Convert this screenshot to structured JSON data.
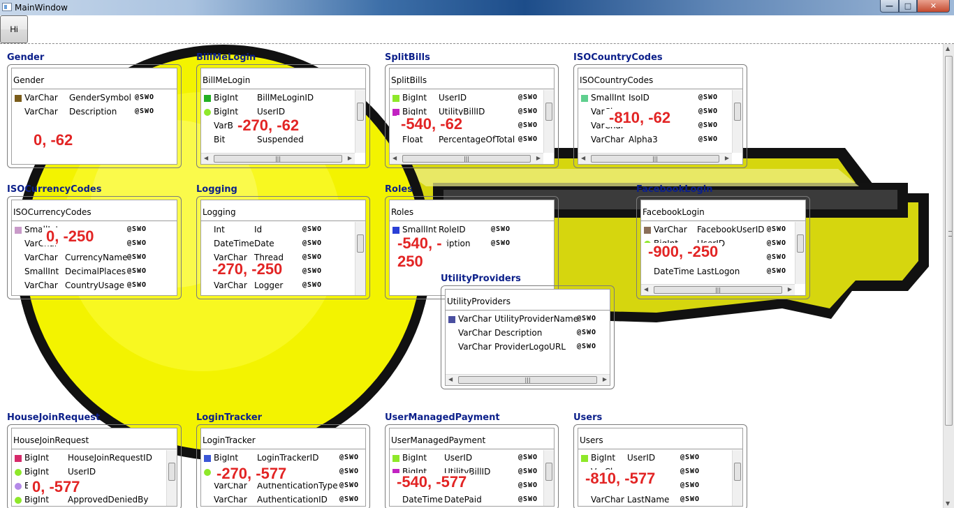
{
  "window": {
    "title": "MainWindow",
    "minimize": "—",
    "maximize": "□",
    "close": "✕"
  },
  "toolbar": {
    "hi_label": "Hi"
  },
  "colors": {
    "title_blue": "#0b1f8a",
    "coord_red": "#e22424"
  },
  "tables": [
    {
      "name": "Gender",
      "header": "Gender",
      "coord": "0, -62",
      "rows": [
        {
          "type": "VarChar",
          "col": "GenderSymbol",
          "color": "#7a5c1a",
          "shape": "sq"
        },
        {
          "type": "VarChar",
          "col": "Description",
          "color": "",
          "shape": "none"
        }
      ]
    },
    {
      "name": "BillMeLogin",
      "header": "BillMeLogin",
      "coord": "-270, -62",
      "rows": [
        {
          "type": "BigInt",
          "col": "BillMeLoginID",
          "color": "#22b022",
          "shape": "sq"
        },
        {
          "type": "BigInt",
          "col": "UserID",
          "color": "#8ee82a",
          "shape": "dot"
        },
        {
          "type": "VarBin",
          "col": "",
          "color": "",
          "shape": "none"
        },
        {
          "type": "Bit",
          "col": "Suspended",
          "color": "",
          "shape": "none"
        }
      ]
    },
    {
      "name": "SplitBills",
      "header": "SplitBills",
      "coord": "-540, -62",
      "rows": [
        {
          "type": "BigInt",
          "col": "UserID",
          "color": "#8ee82a",
          "shape": "sq"
        },
        {
          "type": "BigInt",
          "col": "UtilityBillID",
          "color": "#c222c2",
          "shape": "sq"
        },
        {
          "type": "",
          "col": "",
          "color": "",
          "shape": "none"
        },
        {
          "type": "Float",
          "col": "PercentageOfTotal",
          "color": "",
          "shape": "none"
        }
      ]
    },
    {
      "name": "ISOCountryCodes",
      "header": "ISOCountryCodes",
      "coord": "-810, -62",
      "rows": [
        {
          "type": "SmallInt",
          "col": "IsoID",
          "color": "#5fcf8e",
          "shape": "sq"
        },
        {
          "type": "VarCl",
          "col": "",
          "color": "",
          "shape": "none"
        },
        {
          "type": "VarChar",
          "col": "",
          "color": "",
          "shape": "none"
        },
        {
          "type": "VarChar",
          "col": "Alpha3",
          "color": "",
          "shape": "none"
        }
      ]
    },
    {
      "name": "ISOCurrencyCodes",
      "header": "ISOCurrencyCodes",
      "coord": "0, -250",
      "rows": [
        {
          "type": "SmallInt",
          "col": "",
          "color": "#c99ac9",
          "shape": "sq"
        },
        {
          "type": "VarChar",
          "col": "",
          "color": "",
          "shape": "none"
        },
        {
          "type": "VarChar",
          "col": "CurrencyName",
          "color": "",
          "shape": "none"
        },
        {
          "type": "SmallInt",
          "col": "DecimalPlaces",
          "color": "",
          "shape": "none"
        },
        {
          "type": "VarChar",
          "col": "CountryUsage",
          "color": "",
          "shape": "none"
        }
      ]
    },
    {
      "name": "Logging",
      "header": "Logging",
      "coord": "-270, -250",
      "rows": [
        {
          "type": "Int",
          "col": "Id",
          "color": "",
          "shape": "none"
        },
        {
          "type": "DateTime",
          "col": "Date",
          "color": "",
          "shape": "none"
        },
        {
          "type": "VarChar",
          "col": "Thread",
          "color": "",
          "shape": "none"
        },
        {
          "type": "",
          "col": "",
          "color": "",
          "shape": "none"
        },
        {
          "type": "VarChar",
          "col": "Logger",
          "color": "",
          "shape": "none"
        }
      ]
    },
    {
      "name": "Roles",
      "header": "Roles",
      "coord": "-540, -\n250",
      "rows": [
        {
          "type": "SmallInt",
          "col": "RoleID",
          "color": "#2a3fd6",
          "shape": "sq"
        },
        {
          "type": "",
          "col": "cription",
          "color": "",
          "shape": "none"
        }
      ]
    },
    {
      "name": "FacebookLogin",
      "header": "FacebookLogin",
      "coord": "-900, -250",
      "rows": [
        {
          "type": "VarChar",
          "col": "FacebookUserID",
          "color": "#8a6e5a",
          "shape": "sq"
        },
        {
          "type": "BigInt",
          "col": "UserID",
          "color": "#8ee82a",
          "shape": "dot"
        },
        {
          "type": "",
          "col": "",
          "color": "",
          "shape": "none"
        },
        {
          "type": "DateTime",
          "col": "LastLogon",
          "color": "",
          "shape": "none"
        }
      ]
    },
    {
      "name": "UtilityProviders",
      "header": "UtilityProviders",
      "coord": "",
      "rows": [
        {
          "type": "VarChar",
          "col": "UtilityProviderName",
          "color": "#4a4fa0",
          "shape": "sq"
        },
        {
          "type": "VarChar",
          "col": "Description",
          "color": "",
          "shape": "none"
        },
        {
          "type": "VarChar",
          "col": "ProviderLogoURL",
          "color": "",
          "shape": "none"
        }
      ]
    },
    {
      "name": "HouseJoinRequest",
      "header": "HouseJoinRequest",
      "coord": "0, -577",
      "rows": [
        {
          "type": "BigInt",
          "col": "HouseJoinRequestID",
          "color": "#d62a6a",
          "shape": "sq"
        },
        {
          "type": "BigInt",
          "col": "UserID",
          "color": "#8ee82a",
          "shape": "dot"
        },
        {
          "type": "Bi",
          "col": "",
          "color": "#b48ae8",
          "shape": "dot"
        },
        {
          "type": "BigInt",
          "col": "ApprovedDeniedBy",
          "color": "#8ee82a",
          "shape": "dot"
        }
      ]
    },
    {
      "name": "LoginTracker",
      "header": "LoginTracker",
      "coord": "-270, -577",
      "rows": [
        {
          "type": "BigInt",
          "col": "LoginTrackerID",
          "color": "#3a56d6",
          "shape": "sq"
        },
        {
          "type": "B",
          "col": "",
          "color": "#8ee82a",
          "shape": "dot"
        },
        {
          "type": "VarChar",
          "col": "AuthenticationType",
          "color": "",
          "shape": "none"
        },
        {
          "type": "VarChar",
          "col": "AuthenticationID",
          "color": "",
          "shape": "none"
        }
      ]
    },
    {
      "name": "UserManagedPayment",
      "header": "UserManagedPayment",
      "coord": "-540, -577",
      "rows": [
        {
          "type": "BigInt",
          "col": "UserID",
          "color": "#8ee82a",
          "shape": "sq"
        },
        {
          "type": "BigInt",
          "col": "UtilityBillID",
          "color": "#c222c2",
          "shape": "sq"
        },
        {
          "type": "",
          "col": "",
          "color": "",
          "shape": "none"
        },
        {
          "type": "DateTime",
          "col": "DatePaid",
          "color": "",
          "shape": "none"
        }
      ]
    },
    {
      "name": "Users",
      "header": "Users",
      "coord": "-810, -577",
      "rows": [
        {
          "type": "BigInt",
          "col": "UserID",
          "color": "#8ee82a",
          "shape": "sq"
        },
        {
          "type": "VarChar",
          "col": "",
          "color": "",
          "shape": "none"
        },
        {
          "type": "",
          "col": "",
          "color": "",
          "shape": "none"
        },
        {
          "type": "VarChar",
          "col": "LastName",
          "color": "",
          "shape": "none"
        }
      ]
    }
  ],
  "flag_text": "@SWO"
}
